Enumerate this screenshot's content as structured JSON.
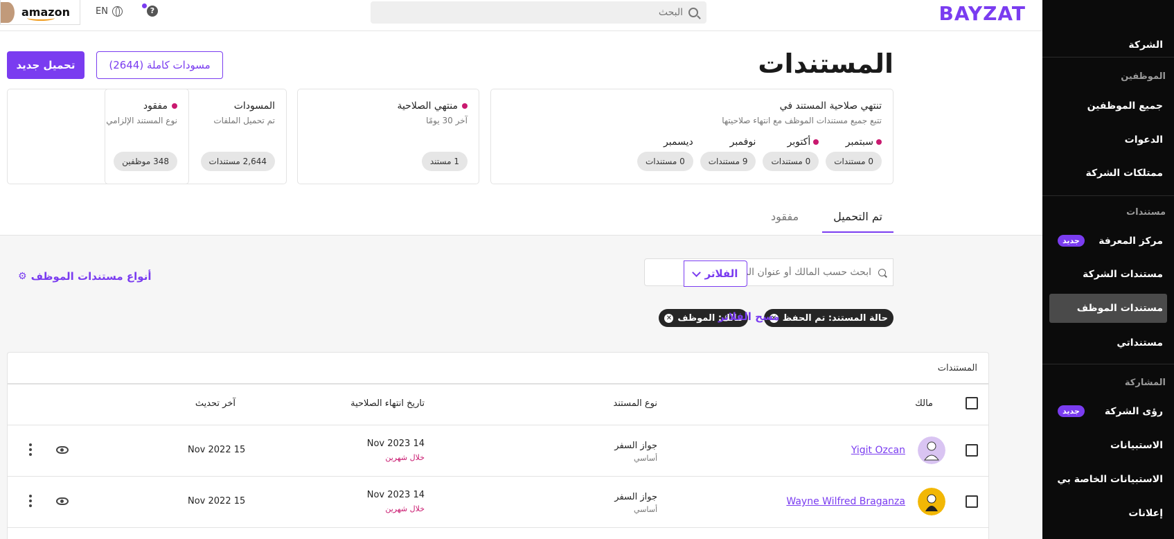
{
  "app": {
    "logo": "BAYZAT",
    "brand_color": "#7a3cf0"
  },
  "topbar": {
    "search_placeholder": "البحث",
    "help": "?",
    "language": "EN",
    "company": "amazon"
  },
  "sidebar": {
    "items": [
      {
        "type": "item",
        "label": "الشركة"
      },
      {
        "type": "section",
        "label": "الموظفين"
      },
      {
        "type": "item",
        "label": "جميع الموظفين"
      },
      {
        "type": "item",
        "label": "الدعوات"
      },
      {
        "type": "item",
        "label": "ممتلكات الشركة"
      },
      {
        "type": "section",
        "label": "مستندات"
      },
      {
        "type": "item",
        "label": "مركز المعرفة",
        "badge": "جديد"
      },
      {
        "type": "item",
        "label": "مستندات الشركة"
      },
      {
        "type": "item",
        "label": "مستندات الموظف",
        "active": true
      },
      {
        "type": "item",
        "label": "مستنداتي"
      },
      {
        "type": "section",
        "label": "المشاركة"
      },
      {
        "type": "item",
        "label": "رؤى الشركة",
        "badge": "جديد"
      },
      {
        "type": "item",
        "label": "الاستبيانات"
      },
      {
        "type": "item",
        "label": "الاستبيانات الخاصة بي"
      },
      {
        "type": "item",
        "label": "إعلانات"
      }
    ]
  },
  "header": {
    "title": "المستندات",
    "upload_button": "تحميل جديد",
    "drafts_button": "مسودات كاملة (2644)"
  },
  "cards": {
    "expiry": {
      "title": "تنتهي صلاحية المستند في",
      "subtitle": "تتبع جميع مستندات الموظف مع انتهاء صلاحيتها",
      "months": [
        {
          "label": "سبتمبر",
          "dot": true,
          "count": "0 مستندات"
        },
        {
          "label": "أكتوبر",
          "dot": true,
          "count": "0 مستندات"
        },
        {
          "label": "نوفمبر",
          "dot": false,
          "count": "9 مستندات"
        },
        {
          "label": "ديسمبر",
          "dot": false,
          "count": "0 مستندات"
        }
      ]
    },
    "expired": {
      "title": "منتهي الصلاحية",
      "subtitle": "آخر 30 يومًا",
      "count": "1 مستند"
    },
    "drafts": {
      "title": "المسودات",
      "subtitle": "تم تحميل الملفات",
      "count": "2,644 مستندات"
    },
    "missing": {
      "title": "مفقود",
      "subtitle": "نوع المستند الإلزامي",
      "count": "348 موظفين"
    }
  },
  "tabs": [
    {
      "label": "تم التحميل",
      "active": true
    },
    {
      "label": "مفقود",
      "active": false
    }
  ],
  "filters": {
    "search_placeholder": "ابحث حسب المالك أو عنوان المستند الآخر",
    "filter_button": "الفلاتر",
    "employee_doc_types": "أنواع مستندات الموظف",
    "chips": [
      "حالة المستند: تم الحفظ",
      "مالك: الموظف"
    ],
    "clear": "مسح الفلاتر"
  },
  "table": {
    "caption": "المستندات",
    "headers": {
      "owner": "مالك",
      "doc_type": "نوع المستند",
      "expiry": "تاريخ انتهاء الصلاحية",
      "updated": "آخر تحديث"
    },
    "rows": [
      {
        "owner": "Yigit Ozcan",
        "doc_type": "جواز السفر",
        "doc_sub": "أساسي",
        "expiry": "14 Nov 2023",
        "expiry_note": "خلال شهرين",
        "updated": "15 Nov 2022",
        "avatar_color": "#d9c4f2"
      },
      {
        "owner": "Wayne Wilfred Braganza",
        "doc_type": "جواز السفر",
        "doc_sub": "أساسي",
        "expiry": "14 Nov 2023",
        "expiry_note": "خلال شهرين",
        "updated": "15 Nov 2022",
        "avatar_color": "#f2b705"
      }
    ]
  }
}
